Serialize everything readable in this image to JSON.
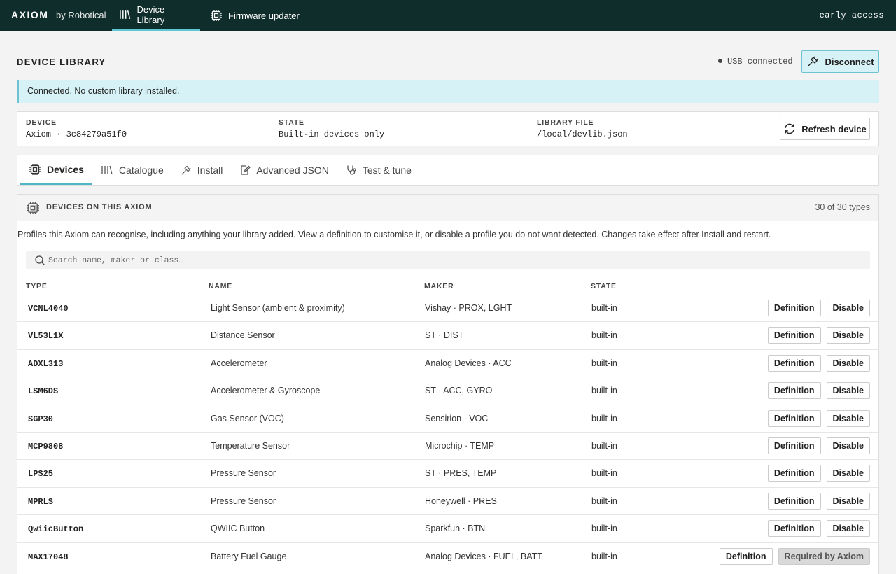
{
  "topbar": {
    "brand": "AXIOM",
    "brand_by": "by Robotical",
    "nav": [
      {
        "label": "Device Library"
      },
      {
        "label": "Firmware updater"
      }
    ],
    "early_access": "early access"
  },
  "header": {
    "title": "DEVICE LIBRARY",
    "usb_status": "USB connected",
    "disconnect_label": "Disconnect"
  },
  "banner": "Connected. No custom library installed.",
  "device_card": {
    "device_label": "DEVICE",
    "device_value": "Axiom · 3c84279a51f0",
    "state_label": "STATE",
    "state_value": "Built-in devices only",
    "library_label": "LIBRARY FILE",
    "library_value": "/local/devlib.json",
    "refresh_label": "Refresh device"
  },
  "tabs": [
    {
      "label": "Devices"
    },
    {
      "label": "Catalogue"
    },
    {
      "label": "Install"
    },
    {
      "label": "Advanced JSON"
    },
    {
      "label": "Test & tune"
    }
  ],
  "panel": {
    "title": "DEVICES ON THIS AXIOM",
    "count": "30 of 30 types",
    "description": "Profiles this Axiom can recognise, including anything your library added. View a definition to customise it, or disable a profile you do not want detected. Changes take effect after Install and restart.",
    "search_placeholder": "Search name, maker or class…",
    "columns": [
      "TYPE",
      "NAME",
      "MAKER",
      "STATE"
    ]
  },
  "rows": [
    {
      "type": "VCNL4040",
      "name": "Light Sensor (ambient & proximity)",
      "maker": "Vishay · PROX, LGHT",
      "state": "built-in",
      "definition": "Definition",
      "action": "Disable"
    },
    {
      "type": "VL53L1X",
      "name": "Distance Sensor",
      "maker": "ST · DIST",
      "state": "built-in",
      "definition": "Definition",
      "action": "Disable"
    },
    {
      "type": "ADXL313",
      "name": "Accelerometer",
      "maker": "Analog Devices · ACC",
      "state": "built-in",
      "definition": "Definition",
      "action": "Disable"
    },
    {
      "type": "LSM6DS",
      "name": "Accelerometer & Gyroscope",
      "maker": "ST · ACC, GYRO",
      "state": "built-in",
      "definition": "Definition",
      "action": "Disable"
    },
    {
      "type": "SGP30",
      "name": "Gas Sensor (VOC)",
      "maker": "Sensirion · VOC",
      "state": "built-in",
      "definition": "Definition",
      "action": "Disable"
    },
    {
      "type": "MCP9808",
      "name": "Temperature Sensor",
      "maker": "Microchip · TEMP",
      "state": "built-in",
      "definition": "Definition",
      "action": "Disable"
    },
    {
      "type": "LPS25",
      "name": "Pressure Sensor",
      "maker": "ST · PRES, TEMP",
      "state": "built-in",
      "definition": "Definition",
      "action": "Disable"
    },
    {
      "type": "MPRLS",
      "name": "Pressure Sensor",
      "maker": "Honeywell · PRES",
      "state": "built-in",
      "definition": "Definition",
      "action": "Disable"
    },
    {
      "type": "QwiicButton",
      "name": "QWIIC Button",
      "maker": "Sparkfun · BTN",
      "state": "built-in",
      "definition": "Definition",
      "action": "Disable"
    },
    {
      "type": "MAX17048",
      "name": "Battery Fuel Gauge",
      "maker": "Analog Devices · FUEL, BATT",
      "state": "built-in",
      "definition": "Definition",
      "action": "Required by Axiom"
    }
  ]
}
